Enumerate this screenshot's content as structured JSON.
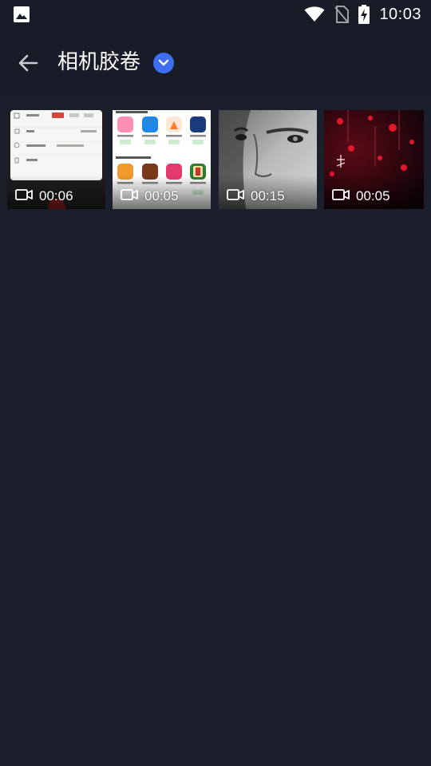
{
  "status_bar": {
    "time": "10:03",
    "icons": [
      "image-notification-icon",
      "wifi-icon",
      "no-sim-icon",
      "battery-charging-icon"
    ]
  },
  "header": {
    "title": "相机胶卷",
    "back_icon": "arrow-left-icon",
    "dropdown_icon": "chevron-down-icon",
    "accent_color": "#3d6ff0"
  },
  "videos": [
    {
      "duration": "00:06",
      "thumbnail": "settings-screen-thumbnail"
    },
    {
      "duration": "00:05",
      "thumbnail": "app-grid-screen-thumbnail"
    },
    {
      "duration": "00:15",
      "thumbnail": "face-closeup-thumbnail"
    },
    {
      "duration": "00:05",
      "thumbnail": "dark-red-scene-thumbnail"
    }
  ],
  "colors": {
    "background": "#1b1f2c",
    "header_background": "#181c28"
  }
}
